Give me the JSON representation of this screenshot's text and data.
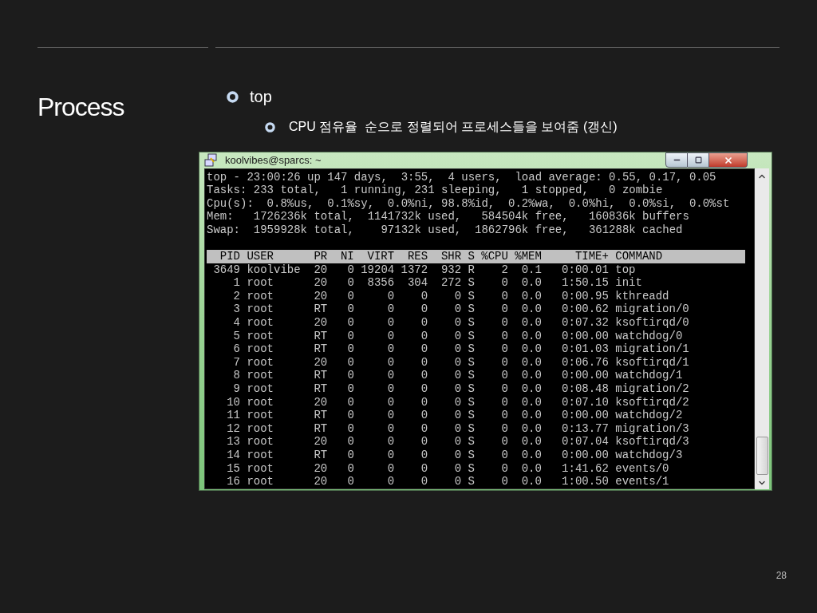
{
  "slide": {
    "title": "Process",
    "bullets": [
      {
        "text": "top",
        "children": [
          {
            "text": "CPU 점유율  순으로 정렬되어 프로세스들을 보여줌 (갱신)"
          }
        ]
      }
    ]
  },
  "terminal": {
    "title": "koolvibes@sparcs: ~",
    "summary_lines": [
      "top - 23:00:26 up 147 days,  3:55,  4 users,  load average: 0.55, 0.17, 0.05",
      "Tasks: 233 total,   1 running, 231 sleeping,   1 stopped,   0 zombie",
      "Cpu(s):  0.8%us,  0.1%sy,  0.0%ni, 98.8%id,  0.2%wa,  0.0%hi,  0.0%si,  0.0%st",
      "Mem:   1726236k total,  1141732k used,   584504k free,   160836k buffers",
      "Swap:  1959928k total,    97132k used,  1862796k free,   361288k cached"
    ],
    "table": {
      "columns": [
        "PID",
        "USER",
        "PR",
        "NI",
        "VIRT",
        "RES",
        "SHR",
        "S",
        "%CPU",
        "%MEM",
        "TIME+",
        "COMMAND"
      ],
      "rows": [
        [
          "3649",
          "koolvibe",
          "20",
          "0",
          "19204",
          "1372",
          "932",
          "R",
          "2",
          "0.1",
          "0:00.01",
          "top"
        ],
        [
          "1",
          "root",
          "20",
          "0",
          "8356",
          "304",
          "272",
          "S",
          "0",
          "0.0",
          "1:50.15",
          "init"
        ],
        [
          "2",
          "root",
          "20",
          "0",
          "0",
          "0",
          "0",
          "S",
          "0",
          "0.0",
          "0:00.95",
          "kthreadd"
        ],
        [
          "3",
          "root",
          "RT",
          "0",
          "0",
          "0",
          "0",
          "S",
          "0",
          "0.0",
          "0:00.62",
          "migration/0"
        ],
        [
          "4",
          "root",
          "20",
          "0",
          "0",
          "0",
          "0",
          "S",
          "0",
          "0.0",
          "0:07.32",
          "ksoftirqd/0"
        ],
        [
          "5",
          "root",
          "RT",
          "0",
          "0",
          "0",
          "0",
          "S",
          "0",
          "0.0",
          "0:00.00",
          "watchdog/0"
        ],
        [
          "6",
          "root",
          "RT",
          "0",
          "0",
          "0",
          "0",
          "S",
          "0",
          "0.0",
          "0:01.03",
          "migration/1"
        ],
        [
          "7",
          "root",
          "20",
          "0",
          "0",
          "0",
          "0",
          "S",
          "0",
          "0.0",
          "0:06.76",
          "ksoftirqd/1"
        ],
        [
          "8",
          "root",
          "RT",
          "0",
          "0",
          "0",
          "0",
          "S",
          "0",
          "0.0",
          "0:00.00",
          "watchdog/1"
        ],
        [
          "9",
          "root",
          "RT",
          "0",
          "0",
          "0",
          "0",
          "S",
          "0",
          "0.0",
          "0:08.48",
          "migration/2"
        ],
        [
          "10",
          "root",
          "20",
          "0",
          "0",
          "0",
          "0",
          "S",
          "0",
          "0.0",
          "0:07.10",
          "ksoftirqd/2"
        ],
        [
          "11",
          "root",
          "RT",
          "0",
          "0",
          "0",
          "0",
          "S",
          "0",
          "0.0",
          "0:00.00",
          "watchdog/2"
        ],
        [
          "12",
          "root",
          "RT",
          "0",
          "0",
          "0",
          "0",
          "S",
          "0",
          "0.0",
          "0:13.77",
          "migration/3"
        ],
        [
          "13",
          "root",
          "20",
          "0",
          "0",
          "0",
          "0",
          "S",
          "0",
          "0.0",
          "0:07.04",
          "ksoftirqd/3"
        ],
        [
          "14",
          "root",
          "RT",
          "0",
          "0",
          "0",
          "0",
          "S",
          "0",
          "0.0",
          "0:00.00",
          "watchdog/3"
        ],
        [
          "15",
          "root",
          "20",
          "0",
          "0",
          "0",
          "0",
          "S",
          "0",
          "0.0",
          "1:41.62",
          "events/0"
        ],
        [
          "16",
          "root",
          "20",
          "0",
          "0",
          "0",
          "0",
          "S",
          "0",
          "0.0",
          "1:00.50",
          "events/1"
        ]
      ]
    }
  },
  "page_number": "28"
}
